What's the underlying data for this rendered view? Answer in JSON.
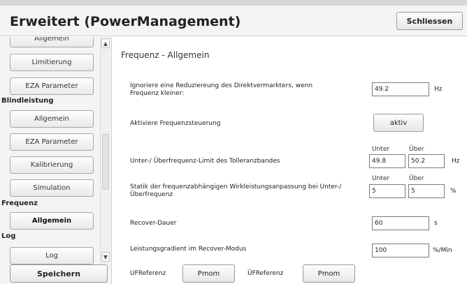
{
  "window": {
    "title": "Erweitert (PowerManagement)",
    "close_label": "Schliessen"
  },
  "sidebar": {
    "items": [
      {
        "label": "Allgemein"
      },
      {
        "label": "Limitierung"
      },
      {
        "label": "EZA Parameter"
      },
      {
        "label": "Allgemein"
      },
      {
        "label": "EZA Parameter"
      },
      {
        "label": "Kalibrierung"
      },
      {
        "label": "Simulation"
      },
      {
        "label": "Allgemein"
      },
      {
        "label": "Log"
      }
    ],
    "sections": [
      "Blindleistung",
      "Frequenz",
      "Log"
    ],
    "active_item": "Allgemein",
    "save_label": "Speichern"
  },
  "main": {
    "section_title": "Frequenz - Allgemein",
    "rows": {
      "ignore_reduction": {
        "label_line1": "Ignoriere eine Reduziereung des Direktvermarkters, wenn",
        "label_line2": "Frequenz kleiner:",
        "value": "49.2",
        "unit": "Hz"
      },
      "activate_control": {
        "label": "Aktiviere Frequenzsteuerung",
        "button_label": "aktiv"
      },
      "freq_limits": {
        "label": "Unter-/ Überfrequenz-Limit des Tolleranzbandes",
        "under_label": "Unter",
        "over_label": "Über",
        "under_value": "49.8",
        "over_value": "50.2",
        "unit": "Hz"
      },
      "statik": {
        "label_line1": "Statik der frequenzabhängigen Wirkleistungsanpassung bei Unter-/",
        "label_line2": "Überfrequenz",
        "under_label": "Unter",
        "over_label": "Über",
        "under_value": "5",
        "over_value": "5",
        "unit": "%"
      },
      "recover_duration": {
        "label": "Recover-Dauer",
        "value": "60",
        "unit": "s"
      },
      "power_gradient": {
        "label": "Leistungsgradient im Recover-Modus",
        "value": "100",
        "unit": "%/Min"
      },
      "references": {
        "uf_label": "UFReferenz",
        "uf_button": "Pmom",
        "of_label": "ÜFReferenz",
        "of_button": "Pmom"
      }
    }
  },
  "colors": {
    "header_bg": "#f4f4f4",
    "sidebar_bg": "#f4f4f4",
    "content_bg": "#ffffff",
    "button_border": "#9a9a9a"
  },
  "icons": {
    "scroll_up": "chevron-up-icon",
    "scroll_down": "chevron-down-icon"
  }
}
